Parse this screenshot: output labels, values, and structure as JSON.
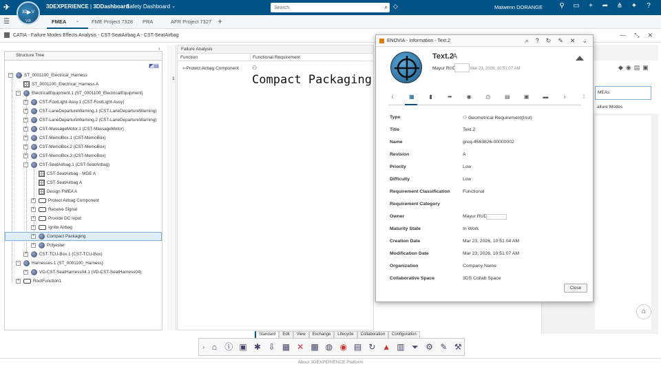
{
  "topbar": {
    "app_brand": "3DEXPERIENCE",
    "app_module": "3DDashboard",
    "dashboard": "Safety Dashboard",
    "compass_left": "3D",
    "compass_right": "V",
    "compass_version": "V.R",
    "search_placeholder": "Search",
    "user": "Maiwenn DORANGE",
    "accent": "#005386"
  },
  "tabs": [
    {
      "label": "FMEA"
    },
    {
      "label": "FME Project 7328"
    },
    {
      "label": "PRA"
    },
    {
      "label": "AFR Project 7327"
    }
  ],
  "window": {
    "title": "CATIA - Failure Modes Effects Analysis - CST-SeatAirbag A - CST-SeatAirbag"
  },
  "tree": {
    "header": "Structure Tree",
    "nodes": [
      {
        "label": "ST_0001100_Electrical_Harness"
      },
      {
        "label": "ST_0001100_Electrical_Harness A"
      },
      {
        "label": "ElectricalEquipment.1 (ST_0001100_ElectricalEquipment)"
      },
      {
        "label": "CST-FootLight-Assy.1 (CST-FootLight-Assy)"
      },
      {
        "label": "CST-LaneDepartureWarning.1 (CST-LaneDepartureWarning)"
      },
      {
        "label": "CST-LaneDepartureWarning.2 (CST-LaneDepartureWarning)"
      },
      {
        "label": "CST-MassageMotor.1 (CST-MassageMotor)"
      },
      {
        "label": "CST-MemoBox.1 (CST-MemoBox)"
      },
      {
        "label": "CST-MemoBox.2 (CST-MemoBox)"
      },
      {
        "label": "CST-MemoBox.3 (CST-MemoBox)"
      },
      {
        "label": "CST-SeatAirbag.1 (CST-SeatAirbag)"
      },
      {
        "label": "CST-SeatAirbag - MGE A"
      },
      {
        "label": "CST-SeatAirbag A"
      },
      {
        "label": "Design FMEA A"
      },
      {
        "label": "Protect Airbag Component"
      },
      {
        "label": "Receive Signal"
      },
      {
        "label": "Provide DC Input"
      },
      {
        "label": "Ignite Airbag"
      },
      {
        "label": "Compact Packaging"
      },
      {
        "label": "Polyester"
      },
      {
        "label": "CST-TCU-Box.1 (CST-TCU-Box)"
      },
      {
        "label": "Harnesses.1 (ST_0001100_Harness)"
      },
      {
        "label": "VD-CST-SeatHarness04.1 (VD-CST-SeatHarness04)"
      },
      {
        "label": "RootFunction1"
      }
    ]
  },
  "failure_analysis": {
    "header": "Failure Analysis",
    "col_function": "Function",
    "col_requirement": "Functional Requirement",
    "row_number": "1",
    "function_value": "Protect Airbag Component",
    "requirement_value": "Compact Packaging"
  },
  "right_panel": {
    "item1": "MEAs",
    "item2": "ailure Modes"
  },
  "dialog": {
    "title": "ENOVIA - Information - Text.2",
    "name": "Text.2",
    "revision": "A",
    "owner": "Mayur RUD",
    "date": "Mar 23, 2026, 10:51:07 AM",
    "properties": [
      {
        "label": "Type",
        "value": "Geometrical Requirement(Inst)"
      },
      {
        "label": "Title",
        "value": "Text.2"
      },
      {
        "label": "Name",
        "value": "greq-4563826-00000002"
      },
      {
        "label": "Revision",
        "value": "A"
      },
      {
        "label": "Priority",
        "value": "Low"
      },
      {
        "label": "Difficulty",
        "value": "Low"
      },
      {
        "label": "Requirement Classification",
        "value": "Functional"
      },
      {
        "label": "Requirement Category",
        "value": ""
      },
      {
        "label": "Owner",
        "value": "Mayur RUD"
      },
      {
        "label": "Maturity State",
        "value": "In Work"
      },
      {
        "label": "Creation Date",
        "value": "Mar 23, 2026, 10:51:04 AM"
      },
      {
        "label": "Modification Date",
        "value": "Mar 23, 2026, 10:51:07 AM"
      },
      {
        "label": "Organization",
        "value": "Company Name"
      },
      {
        "label": "Collaborative Space",
        "value": "3DS Collab Space"
      }
    ],
    "close_label": "Close"
  },
  "section_tabs": [
    "Standard",
    "Edit",
    "View",
    "Exchange",
    "Lifecycle",
    "Collaboration",
    "Configuration"
  ],
  "footer": "About 3DEXPERIENCE Platform"
}
